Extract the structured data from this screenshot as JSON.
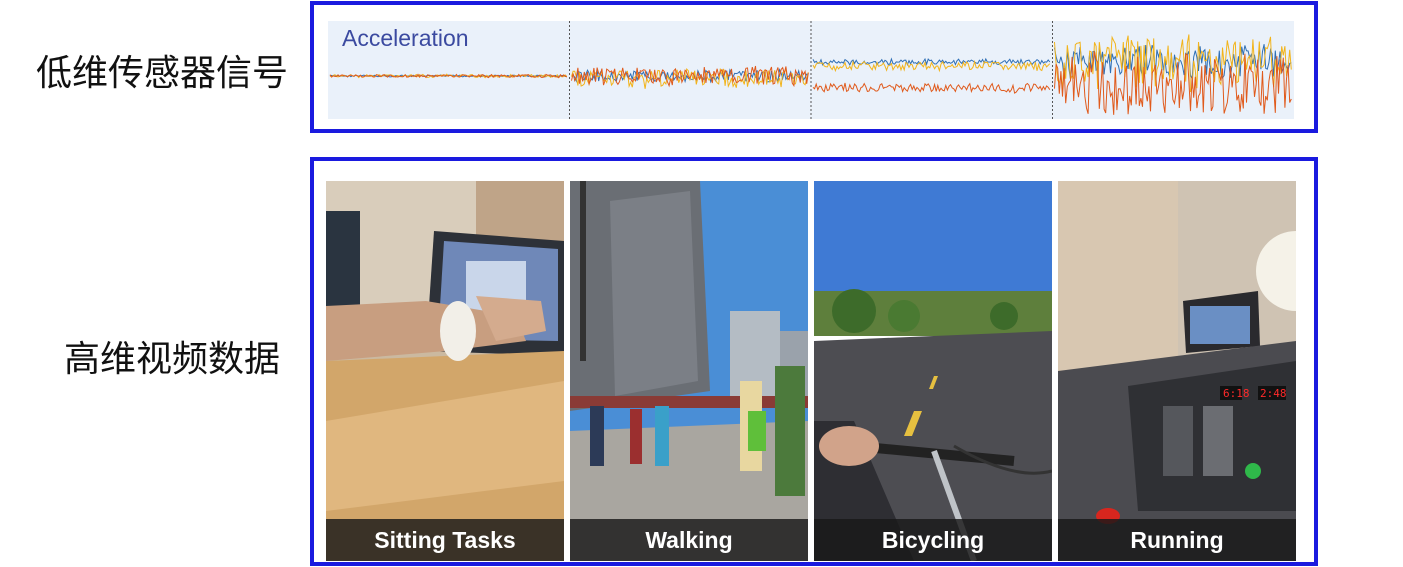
{
  "labels": {
    "signal_row": "低维传感器信号",
    "video_row": "高维视频数据"
  },
  "signal": {
    "title": "Acceleration",
    "series_colors": [
      "#2f6fb5",
      "#e05a1c",
      "#f2b41b"
    ],
    "segments": [
      {
        "activity": "sitting",
        "amplitude": 0.04
      },
      {
        "activity": "walking",
        "amplitude": 0.25
      },
      {
        "activity": "bicycling",
        "amplitude": 0.12
      },
      {
        "activity": "running",
        "amplitude": 0.7
      }
    ]
  },
  "activities": [
    {
      "caption": "Sitting Tasks",
      "scene": "laptop-desk"
    },
    {
      "caption": "Walking",
      "scene": "city-street"
    },
    {
      "caption": "Bicycling",
      "scene": "road-bike"
    },
    {
      "caption": "Running",
      "scene": "treadmill"
    }
  ]
}
